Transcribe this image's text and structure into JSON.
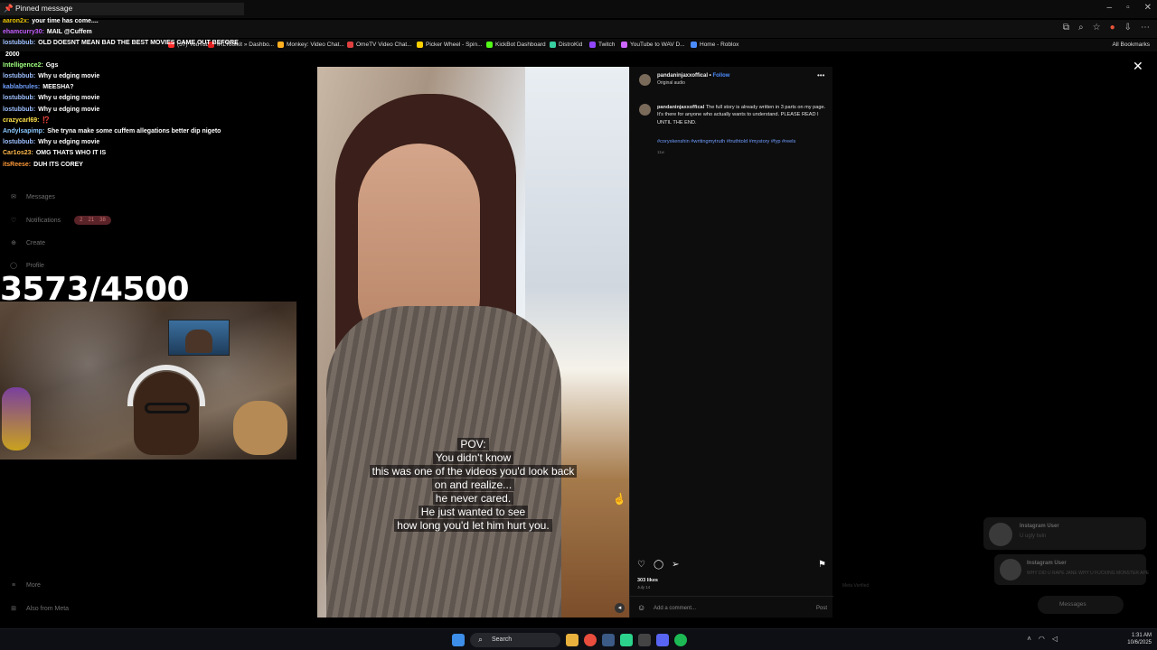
{
  "browser": {
    "window_controls": [
      "–",
      "▫",
      "✕"
    ],
    "toolbar_icons": [
      "⧉",
      "⌕",
      "☆",
      "●",
      "⇩",
      "⋯"
    ],
    "bookmarks": [
      {
        "label": "(57) YouTube",
        "color": "#ff2b2b"
      },
      {
        "label": "IRLToolkit » Dashbo...",
        "color": "#e02020"
      },
      {
        "label": "Monkey: Video Chat...",
        "color": "#ffb020"
      },
      {
        "label": "OmeTV Video Chat...",
        "color": "#e04040"
      },
      {
        "label": "Picker Wheel - Spin...",
        "color": "#ffd000"
      },
      {
        "label": "KickBot Dashboard",
        "color": "#53fc18"
      },
      {
        "label": "DistroKid",
        "color": "#38d0a0"
      },
      {
        "label": "Twitch",
        "color": "#9146ff"
      },
      {
        "label": "YouTube to WAV D...",
        "color": "#cc66ff"
      },
      {
        "label": "Home - Roblox",
        "color": "#4a8cff"
      }
    ],
    "all_bookmarks": "All Bookmarks"
  },
  "chat": {
    "pinned_label": "Pinned message",
    "lines": [
      {
        "user": "aaron2x:",
        "color": "#e6c200",
        "text": "your time has come...."
      },
      {
        "user": "ehamcurry30:",
        "color": "#c45cff",
        "text": "MAIL @Cuffem"
      },
      {
        "user": "lostubbub:",
        "color": "#9ec0ff",
        "text": "OLD DOESNT MEAN BAD THE BEST MOVIES CAME OUT BEFORE"
      },
      {
        "user": "",
        "color": "#ffffff",
        "text": "2000"
      },
      {
        "user": "Intelligence2:",
        "color": "#a0ff80",
        "text": "Ggs"
      },
      {
        "user": "lostubbub:",
        "color": "#9ec0ff",
        "text": "Why u edging movie"
      },
      {
        "user": "kablabrules:",
        "color": "#6fa0ff",
        "text": "MEESHA?"
      },
      {
        "user": "lostubbub:",
        "color": "#9ec0ff",
        "text": "Why u edging movie"
      },
      {
        "user": "lostubbub:",
        "color": "#9ec0ff",
        "text": "Why u edging movie"
      },
      {
        "user": "crazycarl69:",
        "color": "#ffe14a",
        "text": "⁉️"
      },
      {
        "user": "Andylsapimp:",
        "color": "#8cc8ff",
        "text": "She tryna make some cuffem allegations better dip nigeto"
      },
      {
        "user": "lostubbub:",
        "color": "#9ec0ff",
        "text": "Why u edging movie"
      },
      {
        "user": "Car1os23:",
        "color": "#ffb84a",
        "text": "OMG THATS WHO IT IS"
      },
      {
        "user": "itsReese:",
        "color": "#ff9a3a",
        "text": "DUH ITS COREY"
      }
    ]
  },
  "ig_nav": {
    "messages": "Messages",
    "notifications": "Notifications",
    "notif_counts": [
      "2",
      "21",
      "38"
    ],
    "create": "Create",
    "profile": "Profile",
    "more": "More",
    "also_from_meta": "Also from Meta"
  },
  "counter": "3573/4500",
  "video": {
    "caption_lines": [
      "POV:",
      "You didn't know",
      "this was one of the videos you'd look back",
      "on and realize...",
      "he never cared.",
      "He just wanted to see",
      "how long you'd let him hurt you."
    ]
  },
  "post": {
    "username": "pandaninjaxxoffical",
    "follow": "Follow",
    "audio": "Original audio",
    "caption_user": "pandaninjaxxoffical",
    "caption_text": "The full story is already written in 3 parts on my page. It's there for anyone who actually wants to understand. PLEASE READ I UNTIL THE END.",
    "hashtags": "#coryxkenshin #writingmytruth #truthtold #mystory #fyp #reels",
    "age": "11w",
    "likes": "303 likes",
    "date": "July 14",
    "comment_placeholder": "Add a comment...",
    "post_label": "Post"
  },
  "toasts": [
    {
      "name": "Instagram User",
      "message": "U ugly twin"
    },
    {
      "name": "Instagram User",
      "message": "WHY DID U RAPE JANE WHY U FUCKING MONSTER APE"
    }
  ],
  "messages_pill": "Messages",
  "meta_verified": "Meta Verified",
  "taskbar": {
    "search": "Search",
    "time": "1:31 AM",
    "date": "10/6/2025"
  }
}
